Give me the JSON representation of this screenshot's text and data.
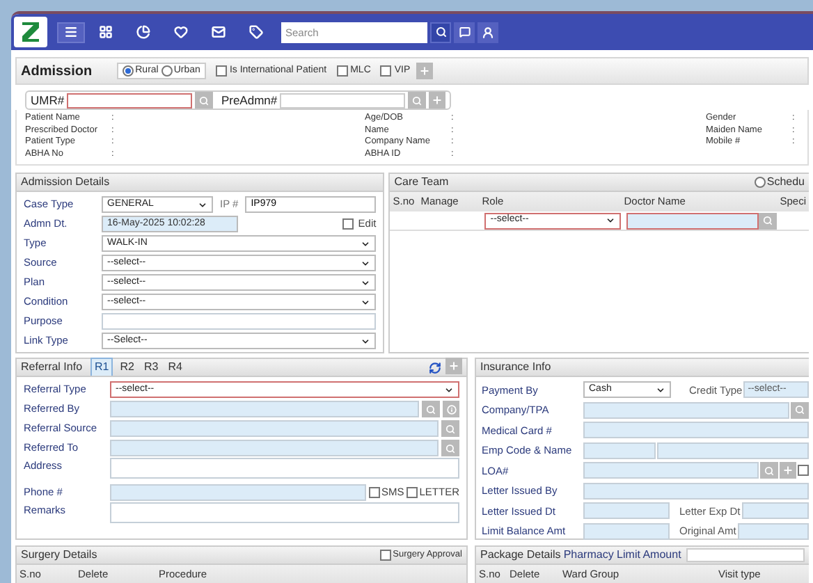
{
  "navbar": {
    "search": {
      "placeholder": "Search"
    }
  },
  "admission_bar": {
    "title": "Admission",
    "area": [
      {
        "label": "Rural",
        "selected": true
      },
      {
        "label": "Urban",
        "selected": false
      }
    ],
    "flags": [
      {
        "label": "Is International Patient",
        "checked": false
      },
      {
        "label": "MLC",
        "checked": false
      },
      {
        "label": "VIP",
        "checked": false
      }
    ]
  },
  "lookup": {
    "umr_label": "UMR#",
    "preadmn_label": "PreAdmn#"
  },
  "patient_info": [
    [
      {
        "label": "Patient Name",
        "colon": ":"
      },
      {
        "label": "Prescribed Doctor",
        "colon": ":"
      },
      {
        "label": "Patient Type",
        "colon": ":"
      },
      {
        "label": "ABHA No",
        "colon": ":"
      }
    ],
    [
      {
        "label": "Age/DOB",
        "colon": ":"
      },
      {
        "label": "Name",
        "colon": ":"
      },
      {
        "label": "Company Name",
        "colon": ":"
      },
      {
        "label": "ABHA ID",
        "colon": ":"
      }
    ],
    [
      {
        "label": "Gender",
        "colon": ":"
      },
      {
        "label": "Maiden Name",
        "colon": ":"
      },
      {
        "label": "Mobile #",
        "colon": ":"
      }
    ]
  ],
  "admission_details": {
    "title": "Admission Details",
    "fields": [
      {
        "label": "Case Type",
        "kind": "select_ip",
        "value": "GENERAL",
        "extra_label": "IP #",
        "extra_value": "IP979"
      },
      {
        "label": "Admn Dt.",
        "kind": "date",
        "value": "16-May-2025 10:02:28",
        "check_label": "Edit",
        "checked": false
      },
      {
        "label": "Type",
        "kind": "select",
        "value": "WALK-IN"
      },
      {
        "label": "Source",
        "kind": "select",
        "value": "--select--"
      },
      {
        "label": "Plan",
        "kind": "select",
        "value": "--select--"
      },
      {
        "label": "Condition",
        "kind": "select",
        "value": "--select--"
      },
      {
        "label": "Purpose",
        "kind": "text"
      },
      {
        "label": "Link Type",
        "kind": "select",
        "value": "--Select--"
      }
    ]
  },
  "care_team": {
    "title": "Care Team",
    "schedule": {
      "label": "Schedu",
      "selected": false
    },
    "columns": [
      "S.no",
      "Manage",
      "Role",
      "Doctor Name",
      "Speci"
    ],
    "role_value": "--select--"
  },
  "referral": {
    "title": "Referral Info",
    "tabs": [
      {
        "label": "R1",
        "selected": true
      },
      {
        "label": "R2",
        "selected": false
      },
      {
        "label": "R3",
        "selected": false
      },
      {
        "label": "R4",
        "selected": false
      }
    ],
    "fields": [
      {
        "label": "Referral Type",
        "kind": "select",
        "value": "--select--",
        "required": true
      },
      {
        "label": "Referred By",
        "kind": "lookup_info"
      },
      {
        "label": "Referral Source",
        "kind": "lookup"
      },
      {
        "label": "Referred To",
        "kind": "lookup"
      },
      {
        "label": "Address",
        "kind": "textarea"
      },
      {
        "label": "Phone #",
        "kind": "phone",
        "checks": [
          {
            "label": "SMS",
            "checked": false
          },
          {
            "label": "LETTER",
            "checked": false
          }
        ]
      },
      {
        "label": "Remarks",
        "kind": "textarea"
      }
    ]
  },
  "insurance": {
    "title": "Insurance Info",
    "fields": [
      {
        "label": "Payment By",
        "kind": "select_split",
        "value": "Cash",
        "second_label": "Credit Type",
        "second_value": "--select--"
      },
      {
        "label": "Company/TPA",
        "kind": "lookup"
      },
      {
        "label": "Medical Card #",
        "kind": "text"
      },
      {
        "label": "Emp Code & Name",
        "kind": "pair"
      },
      {
        "label": "LOA#",
        "kind": "loa",
        "checked": false
      },
      {
        "label": "Letter Issued By",
        "kind": "text"
      },
      {
        "label": "Letter Issued Dt",
        "kind": "split",
        "second_label": "Letter Exp Dt"
      },
      {
        "label": "Limit Balance Amt",
        "kind": "split",
        "second_label": "Original Amt"
      }
    ]
  },
  "surgery": {
    "title": "Surgery Details",
    "approval": {
      "label": "Surgery Approval",
      "checked": false
    },
    "columns": [
      "S.no",
      "Delete",
      "Procedure"
    ]
  },
  "package": {
    "title": "Package Details",
    "limit_label": "Pharmacy Limit Amount",
    "columns": [
      "S.no",
      "Delete",
      "Ward Group",
      "Visit type"
    ]
  }
}
